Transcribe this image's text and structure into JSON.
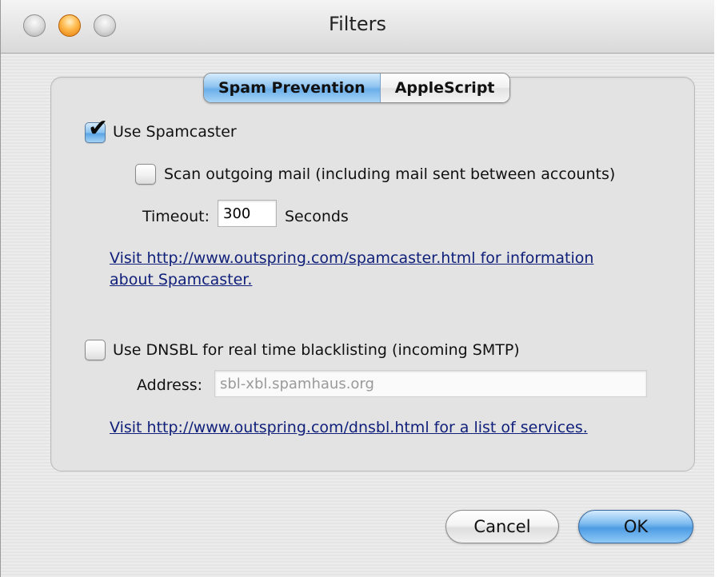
{
  "window": {
    "title": "Filters"
  },
  "tabs": [
    {
      "label": "Spam Prevention",
      "selected": true
    },
    {
      "label": "AppleScript",
      "selected": false
    }
  ],
  "spamcaster": {
    "checkbox_label": "Use Spamcaster",
    "checked": true,
    "scan_outgoing_label": "Scan outgoing mail (including mail sent between accounts)",
    "scan_outgoing_checked": false,
    "timeout_label": "Timeout:",
    "timeout_value": "300",
    "timeout_unit": "Seconds",
    "link_line1": "Visit http://www.outspring.com/spamcaster.html for information",
    "link_line2": "about Spamcaster."
  },
  "dnsbl": {
    "checkbox_label": "Use DNSBL for real time blacklisting (incoming SMTP)",
    "checked": false,
    "address_label": "Address:",
    "address_value": "sbl-xbl.spamhaus.org",
    "link": "Visit http://www.outspring.com/dnsbl.html for a list of services."
  },
  "buttons": {
    "cancel": "Cancel",
    "ok": "OK"
  },
  "colors": {
    "accent": "#6aaee9",
    "link": "#10207a"
  }
}
